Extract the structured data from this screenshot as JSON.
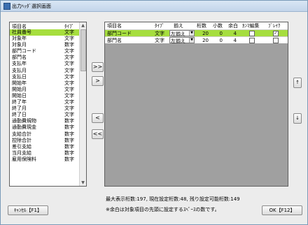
{
  "window": {
    "title": "出力ﾍｯﾀﾞ選択画面"
  },
  "left_list": {
    "columns": [
      "項目名",
      "ﾀｲﾌﾟ"
    ],
    "rows": [
      {
        "name": "社員番号",
        "type": "文字",
        "selected": true
      },
      {
        "name": "対象年",
        "type": "文字"
      },
      {
        "name": "対象月",
        "type": "数字"
      },
      {
        "name": "部門コード",
        "type": "文字"
      },
      {
        "name": "部門名",
        "type": "文字"
      },
      {
        "name": "支払年",
        "type": "文字"
      },
      {
        "name": "支払月",
        "type": "文字"
      },
      {
        "name": "支払日",
        "type": "文字"
      },
      {
        "name": "開始年",
        "type": "文字"
      },
      {
        "name": "開始月",
        "type": "文字"
      },
      {
        "name": "開始日",
        "type": "文字"
      },
      {
        "name": "終了年",
        "type": "文字"
      },
      {
        "name": "終了月",
        "type": "文字"
      },
      {
        "name": "終了日",
        "type": "文字"
      },
      {
        "name": "通勤費規物",
        "type": "数字"
      },
      {
        "name": "通勤費現金",
        "type": "数字"
      },
      {
        "name": "支給合計",
        "type": "数字"
      },
      {
        "name": "控除合計",
        "type": "数字"
      },
      {
        "name": "差引支給",
        "type": "数字"
      },
      {
        "name": "当月支給",
        "type": "数字"
      },
      {
        "name": "雇用保険料",
        "type": "数字"
      }
    ]
  },
  "move_buttons": {
    "add_all": ">>",
    "add": ">",
    "remove": "<",
    "remove_all": "<<"
  },
  "right_grid": {
    "columns": [
      "項目名",
      "ﾀｲﾌﾟ",
      "揃え",
      "桁数",
      "小数",
      "余白",
      "ｶﾝﾏ編集",
      "ﾌﾞﾚｲｸ"
    ],
    "rows": [
      {
        "name": "部門コード",
        "type": "文字",
        "align": "左揃え",
        "digits": "20",
        "decimals": "0",
        "margin": "4",
        "comma": false,
        "break": true,
        "selected": true
      },
      {
        "name": "部門名",
        "type": "文字",
        "align": "左揃え",
        "digits": "20",
        "decimals": "0",
        "margin": "4",
        "comma": false,
        "break": false
      }
    ]
  },
  "order_buttons": {
    "up": "↑",
    "down": "↓"
  },
  "info": {
    "line1": "最大表示桁数:197, 現在設定桁数:48, 残り設定可能桁数:149",
    "line2": "※余白は対象項目の先頭に設定するｽﾍﾟｰｽの数です。"
  },
  "footer": {
    "cancel": "ｷｬﾝｾﾙ【F1】",
    "ok": "OK【F12】"
  }
}
